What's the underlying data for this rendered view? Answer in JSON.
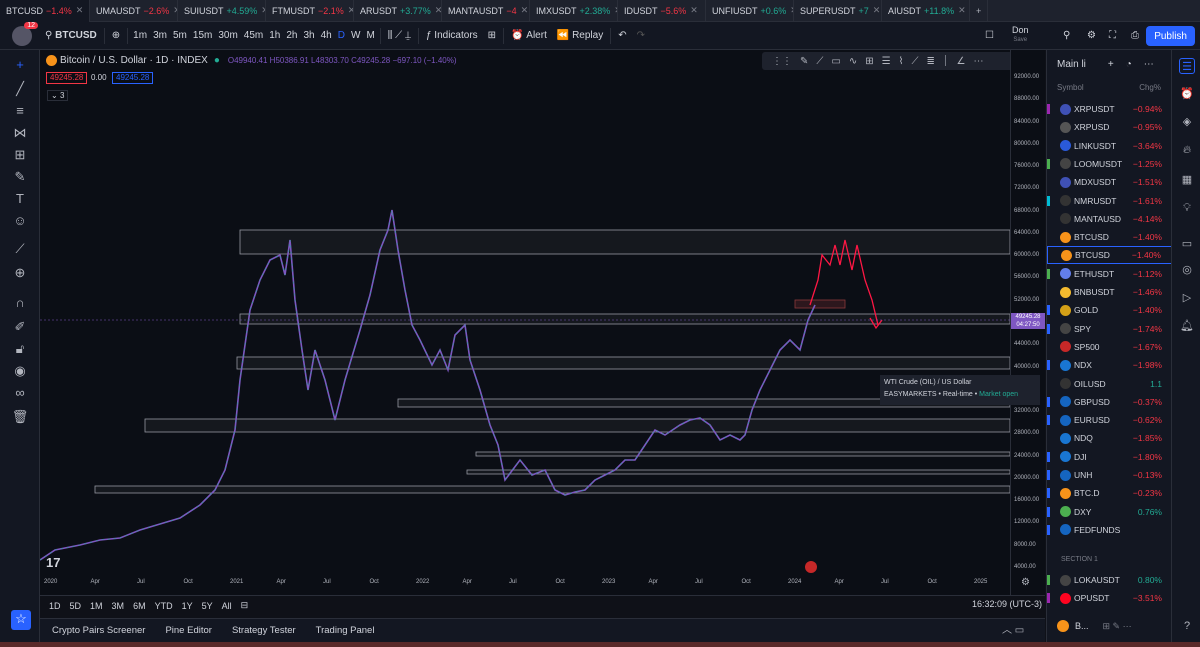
{
  "tabs": [
    {
      "name": "BTCUSD",
      "chg": "−1.4%",
      "cls": "neg"
    },
    {
      "name": "UMAUSDT",
      "chg": "−2.6%",
      "cls": "neg"
    },
    {
      "name": "SUIUSDT",
      "chg": "+4.59%",
      "cls": "pos"
    },
    {
      "name": "FTMUSDT",
      "chg": "−2.1%",
      "cls": "neg"
    },
    {
      "name": "ARUSDT",
      "chg": "+3.77%",
      "cls": "pos"
    },
    {
      "name": "MANTAUSDT",
      "chg": "−4",
      "cls": "neg"
    },
    {
      "name": "IMXUSDT",
      "chg": "+2.38%",
      "cls": "pos"
    },
    {
      "name": "IDUSDT",
      "chg": "−5.6%",
      "cls": "neg"
    },
    {
      "name": "UNFIUSDT",
      "chg": "+0.6%",
      "cls": "pos"
    },
    {
      "name": "SUPERUSDT",
      "chg": "+7",
      "cls": "pos"
    },
    {
      "name": "AIUSDT",
      "chg": "+11.8%",
      "cls": "pos"
    }
  ],
  "toolbar": {
    "notif_count": "12",
    "symbol": "BTCUSD",
    "intervals": [
      "1m",
      "3m",
      "5m",
      "15m",
      "30m",
      "45m",
      "1h",
      "2h",
      "3h",
      "4h",
      "D",
      "W",
      "M"
    ],
    "indicators": "Indicators",
    "alert": "Alert",
    "replay": "Replay",
    "layout_name": "Don",
    "layout_status": "Save",
    "publish": "Publish"
  },
  "legend": {
    "title": "Bitcoin / U.S. Dollar · 1D · INDEX",
    "ohlc": "O49940.41 H50386.91 L48303.70 C49245.28 −697.10 (−1.40%)",
    "bid": "49245.28",
    "spread": "0.00",
    "ask": "49245.28",
    "collapse": "3"
  },
  "price_axis": [
    "92000.00",
    "88000.00",
    "84000.00",
    "80000.00",
    "76000.00",
    "72000.00",
    "68000.00",
    "64000.00",
    "60000.00",
    "56000.00",
    "52000.00",
    "44000.00",
    "40000.00",
    "36000.00",
    "32000.00",
    "28000.00",
    "24000.00",
    "20000.00",
    "16000.00",
    "12000.00",
    "8000.00",
    "4000.00"
  ],
  "last_price": "49245.28",
  "last_time": "04:27:50",
  "time_axis": [
    "2020",
    "Apr",
    "Jul",
    "Oct",
    "2021",
    "Apr",
    "Jul",
    "Oct",
    "2022",
    "Apr",
    "Jul",
    "Oct",
    "2023",
    "Apr",
    "Jul",
    "Oct",
    "2024",
    "Apr",
    "Jul",
    "Oct",
    "2025"
  ],
  "ranges": [
    "1D",
    "5D",
    "1M",
    "3M",
    "6M",
    "YTD",
    "1Y",
    "5Y",
    "All"
  ],
  "clock": "16:32:09 (UTC-3)",
  "bottom_tabs": [
    "Crypto Pairs Screener",
    "Pine Editor",
    "Strategy Tester",
    "Trading Panel"
  ],
  "tooltip": {
    "title": "WTI Crude (OIL) / US Dollar",
    "src": "EASYMARKETS",
    "rt": "Real-time",
    "status": "Market open"
  },
  "watchlist": {
    "name": "Main li",
    "col_symbol": "Symbol",
    "col_chg": "Chg%",
    "rows": [
      {
        "sym": "XRPUSDT",
        "chg": "−0.94%",
        "cls": "neg",
        "ic": "#3f51b5",
        "flag": "#9c27b0"
      },
      {
        "sym": "XRPUSD",
        "chg": "−0.95%",
        "cls": "neg",
        "ic": "#555",
        "flag": ""
      },
      {
        "sym": "LINKUSDT",
        "chg": "−3.64%",
        "cls": "neg",
        "ic": "#2a5ada",
        "flag": ""
      },
      {
        "sym": "LOOMUSDT",
        "chg": "−1.25%",
        "cls": "neg",
        "ic": "#444",
        "flag": "#4caf50"
      },
      {
        "sym": "MDXUSDT",
        "chg": "−1.51%",
        "cls": "neg",
        "ic": "#3f51b5",
        "flag": ""
      },
      {
        "sym": "NMRUSDT",
        "chg": "−1.61%",
        "cls": "neg",
        "ic": "#333",
        "flag": "#00bcd4"
      },
      {
        "sym": "MANTAUSD",
        "chg": "−4.14%",
        "cls": "neg",
        "ic": "#333",
        "flag": ""
      },
      {
        "sym": "BTCUSD",
        "chg": "−1.40%",
        "cls": "neg",
        "ic": "#f7931a",
        "flag": ""
      },
      {
        "sym": "BTCUSD",
        "chg": "−1.40%",
        "cls": "neg",
        "ic": "#f7931a",
        "flag": "",
        "sel": true
      },
      {
        "sym": "ETHUSDT",
        "chg": "−1.12%",
        "cls": "neg",
        "ic": "#627eea",
        "flag": "#4caf50"
      },
      {
        "sym": "BNBUSDT",
        "chg": "−1.46%",
        "cls": "neg",
        "ic": "#f3ba2f",
        "flag": ""
      },
      {
        "sym": "GOLD",
        "chg": "−1.40%",
        "cls": "neg",
        "ic": "#d4a017",
        "flag": "#2962ff"
      },
      {
        "sym": "SPY",
        "chg": "−1.74%",
        "cls": "neg",
        "ic": "#444",
        "flag": "#2962ff"
      },
      {
        "sym": "SP500",
        "chg": "−1.67%",
        "cls": "neg",
        "ic": "#c62828",
        "flag": ""
      },
      {
        "sym": "NDX",
        "chg": "−1.98%",
        "cls": "neg",
        "ic": "#1976d2",
        "flag": "#2962ff"
      },
      {
        "sym": "OILUSD",
        "chg": "1.1",
        "cls": "pos",
        "ic": "#333",
        "flag": ""
      },
      {
        "sym": "GBPUSD",
        "chg": "−0.37%",
        "cls": "neg",
        "ic": "#1565c0",
        "flag": "#2962ff"
      },
      {
        "sym": "EURUSD",
        "chg": "−0.62%",
        "cls": "neg",
        "ic": "#1565c0",
        "flag": "#2962ff"
      },
      {
        "sym": "NDQ",
        "chg": "−1.85%",
        "cls": "neg",
        "ic": "#1976d2",
        "flag": ""
      },
      {
        "sym": "DJI",
        "chg": "−1.80%",
        "cls": "neg",
        "ic": "#1976d2",
        "flag": "#2962ff"
      },
      {
        "sym": "UNH",
        "chg": "−0.13%",
        "cls": "neg",
        "ic": "#1565c0",
        "flag": "#2962ff"
      },
      {
        "sym": "BTC.D",
        "chg": "−0.23%",
        "cls": "neg",
        "ic": "#f7931a",
        "flag": "#2962ff"
      },
      {
        "sym": "DXY",
        "chg": "0.76%",
        "cls": "pos",
        "ic": "#4caf50",
        "flag": "#2962ff"
      },
      {
        "sym": "FEDFUNDS",
        "chg": "",
        "cls": "neg",
        "ic": "#1565c0",
        "flag": "#2962ff"
      }
    ],
    "section": "SECTION 1",
    "rows2": [
      {
        "sym": "LOKAUSDT",
        "chg": "0.80%",
        "cls": "pos",
        "ic": "#444",
        "flag": "#4caf50"
      },
      {
        "sym": "OPUSDT",
        "chg": "−3.51%",
        "cls": "neg",
        "ic": "#ff0420",
        "flag": "#9c27b0"
      }
    ],
    "footer": "B..."
  },
  "colors": {
    "accent": "#2962ff",
    "up": "#22ab94",
    "down": "#f23645",
    "candle": "#7e57c2",
    "projection": "#ff1744"
  }
}
